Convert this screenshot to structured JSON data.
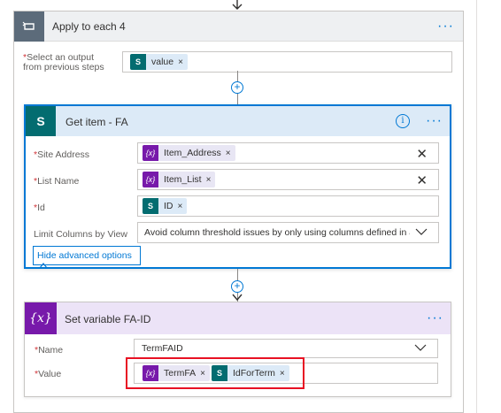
{
  "apply_each": {
    "title": "Apply to each 4",
    "select_label": "Select an output",
    "select_label_2": "from previous steps",
    "token": "value"
  },
  "get_item": {
    "title": "Get item - FA",
    "site_address_label": "Site Address",
    "site_address_token": "Item_Address",
    "list_name_label": "List Name",
    "list_name_token": "Item_List",
    "id_label": "Id",
    "id_token": "ID",
    "limit_columns_label": "Limit Columns by View",
    "limit_columns_value": "Avoid column threshold issues by only using columns defined in a view",
    "advanced_options": "Hide advanced options"
  },
  "set_variable": {
    "title": "Set variable FA-ID",
    "name_label": "Name",
    "name_value": "TermFAID",
    "value_label": "Value",
    "token_1": "TermFA",
    "token_2": "IdForTerm"
  },
  "common": {
    "required_mark": "*",
    "remove_mark": "×",
    "clear_mark": "✕",
    "ellipsis": "···",
    "info_glyph": "i",
    "var_glyph": "{x}",
    "plus_glyph": "+"
  },
  "colors": {
    "accent": "#0078d4",
    "variable": "#7719aa",
    "sharepoint": "#036c70",
    "highlight": "#e81123"
  }
}
